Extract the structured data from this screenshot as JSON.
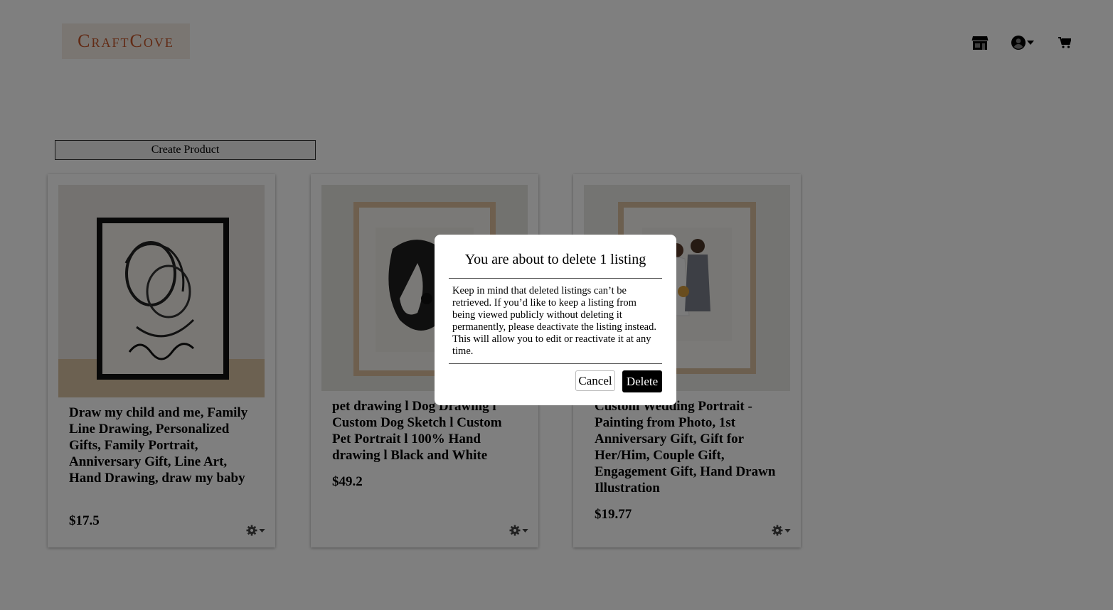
{
  "header": {
    "logo_text": "CraftCove",
    "icons": [
      "store-icon",
      "user-circle-icon",
      "caret-down-icon",
      "cart-icon"
    ]
  },
  "toolbar": {
    "create_label": "Create Product"
  },
  "products": [
    {
      "title": "Draw my child and me, Family Line Drawing, Personalized Gifts, Family Portrait, Anniversary Gift, Line Art, Hand Drawing, draw my baby",
      "price": "$17.5",
      "image_icon": "family-sketch-image"
    },
    {
      "title": "pet drawing l Dog Drawing l Custom Dog Sketch l Custom Pet Portrait l 100% Hand drawing l Black and White",
      "price": "$49.2",
      "image_icon": "dog-sketch-image"
    },
    {
      "title": "Custom Wedding Portrait - Painting from Photo, 1st Anniversary Gift, Gift for Her/Him, Couple Gift, Engagement Gift, Hand Drawn Illustration",
      "price": "$19.77",
      "image_icon": "wedding-portrait-image"
    }
  ],
  "modal": {
    "title": "You are about to delete 1 listing",
    "body": "Keep in mind that deleted listings can’t be retrieved. If you’d like to keep a listing from being viewed publicly without deleting it permanently, please deactivate the listing instead. This will allow you to edit or reactivate it at any time.",
    "cancel_label": "Cancel",
    "delete_label": "Delete"
  },
  "colors": {
    "brand": "#c4562a",
    "overlay": "rgba(0,0,0,0.5)",
    "delete_button": "#000000"
  }
}
